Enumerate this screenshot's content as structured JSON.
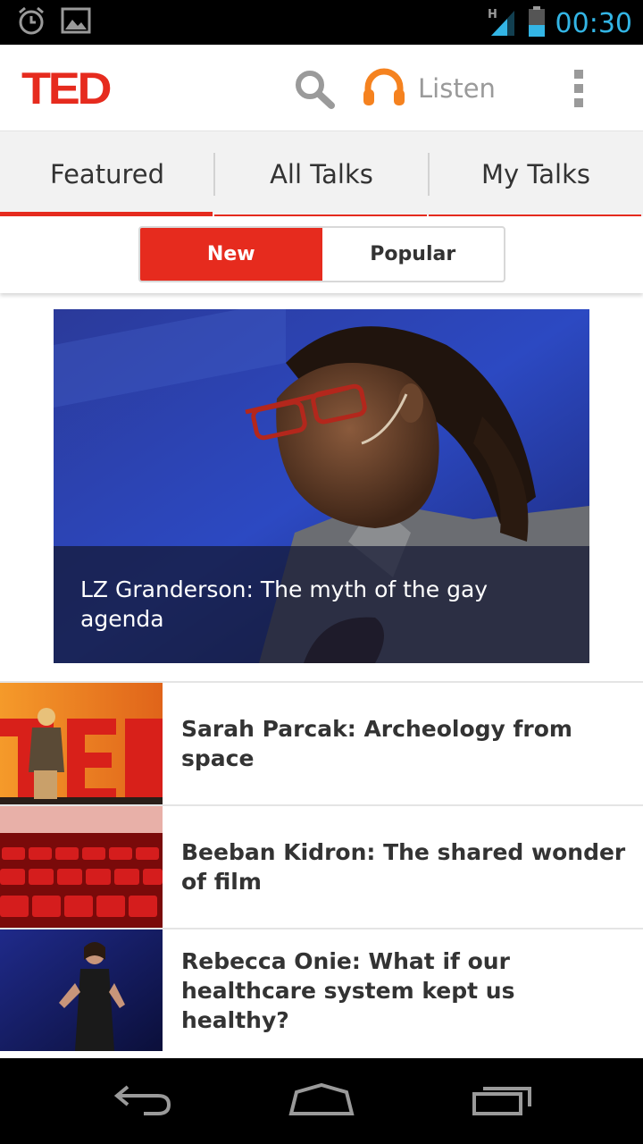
{
  "status_bar": {
    "time": "00:30",
    "network_type": "H"
  },
  "app_bar": {
    "logo_text": "TED",
    "listen_label": "Listen"
  },
  "tabs": [
    {
      "label": "Featured",
      "active": true
    },
    {
      "label": "All Talks",
      "active": false
    },
    {
      "label": "My Talks",
      "active": false
    }
  ],
  "segments": [
    {
      "label": "New",
      "active": true
    },
    {
      "label": "Popular",
      "active": false
    }
  ],
  "featured": {
    "title": "LZ Granderson: The myth of the gay agenda"
  },
  "talks": [
    {
      "title": "Sarah Parcak: Archeology from space"
    },
    {
      "title": "Beeban Kidron: The shared wonder of film"
    },
    {
      "title": "Rebecca Onie: What if our healthcare system kept us healthy?"
    }
  ],
  "colors": {
    "accent": "#e62b1e",
    "listen_icon": "#f5821f",
    "status_blue": "#33b5e5"
  }
}
